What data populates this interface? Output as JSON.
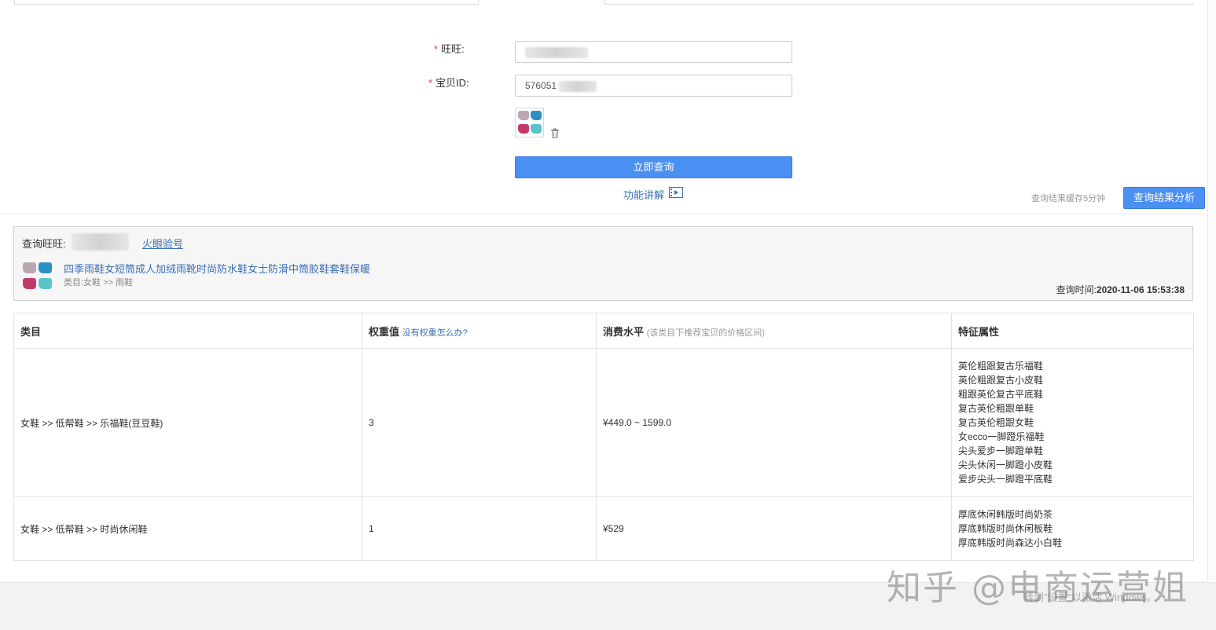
{
  "form": {
    "wangwang_label": "旺旺:",
    "item_id_label": "宝贝ID:",
    "required_mark": "*",
    "item_id_value": "576051",
    "search_button": "立即查询",
    "help_link": "功能讲解",
    "cache_note": "查询结果缓存5分钟",
    "analyze_button": "查询结果分析"
  },
  "result": {
    "query_wangwang_label": "查询旺旺:",
    "verify_link": "火眼验号",
    "item_title": "四季雨鞋女短筒成人加绒雨靴时尚防水鞋女士防滑中筒胶鞋套鞋保暖",
    "item_category": "类目:女鞋 >> 雨鞋",
    "query_time_label": "查询时间:",
    "query_time_value": "2020-11-06 15:53:38"
  },
  "table": {
    "headers": {
      "category": "类目",
      "weight": "权重值",
      "weight_hint": "没有权重怎么办?",
      "spend": "消费水平",
      "spend_hint": "(该类目下推荐宝贝的价格区间)",
      "attributes": "特征属性"
    },
    "rows": [
      {
        "category": "女鞋 >> 低帮鞋 >> 乐福鞋(豆豆鞋)",
        "weight": "3",
        "spend": "¥449.0 ~ 1599.0",
        "attributes": [
          "英伦粗跟复古乐福鞋",
          "英伦粗跟复古小皮鞋",
          "粗跟英伦复古平底鞋",
          "复古英伦粗跟单鞋",
          "复古英伦粗跟女鞋",
          "女ecco一脚蹬乐福鞋",
          "尖头爱步一脚蹬单鞋",
          "尖头休闲一脚蹬小皮鞋",
          "爱步尖头一脚蹬平底鞋"
        ]
      },
      {
        "category": "女鞋 >> 低帮鞋 >> 时尚休闲鞋",
        "weight": "1",
        "spend": "¥529",
        "attributes": [
          "厚底休闲韩版时尚奶茶",
          "厚底韩版时尚休闲板鞋",
          "厚底韩版时尚森达小白鞋"
        ]
      }
    ]
  },
  "overlay": {
    "watermark": "知乎 @电商运营姐",
    "activation": "转到\"设置\"以激活 Windows。"
  },
  "colors": {
    "primary": "#4a8ff2",
    "link": "#3a6fb7",
    "required": "#e4393c"
  },
  "icons": [
    "trash-icon",
    "video-icon",
    "product-thumbnail"
  ]
}
